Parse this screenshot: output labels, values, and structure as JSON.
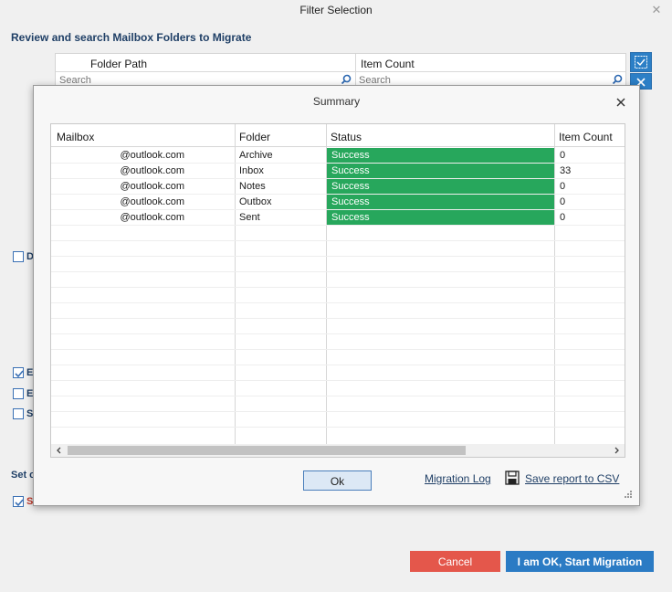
{
  "window": {
    "title": "Filter Selection",
    "heading": "Review and search Mailbox Folders to Migrate"
  },
  "folder_grid": {
    "columns": [
      "Folder Path",
      "Item Count"
    ],
    "search_placeholder": "Search"
  },
  "outer_options": {
    "check_labels": [
      "D",
      "E",
      "E",
      "S"
    ],
    "check_states": [
      false,
      true,
      false,
      false
    ],
    "set_label": "Set c",
    "bottom_check_label": "S",
    "bottom_check_state": true
  },
  "buttons": {
    "cancel": "Cancel",
    "start": "I am OK, Start Migration"
  },
  "summary": {
    "title": "Summary",
    "columns": [
      "Mailbox",
      "Folder",
      "Status",
      "Item Count"
    ],
    "rows": [
      {
        "mailbox": "@outlook.com",
        "folder": "Archive",
        "status": "Success",
        "count": "0"
      },
      {
        "mailbox": "@outlook.com",
        "folder": "Inbox",
        "status": "Success",
        "count": "33"
      },
      {
        "mailbox": "@outlook.com",
        "folder": "Notes",
        "status": "Success",
        "count": "0"
      },
      {
        "mailbox": "@outlook.com",
        "folder": "Outbox",
        "status": "Success",
        "count": "0"
      },
      {
        "mailbox": "@outlook.com",
        "folder": "Sent",
        "status": "Success",
        "count": "0"
      }
    ],
    "ok_label": "Ok",
    "log_link": "Migration Log",
    "save_link": "Save report to CSV",
    "status_color": "#27a75c"
  },
  "colors": {
    "accent": "#2b7bc4",
    "cancel": "#e4574b",
    "heading": "#1f3f66"
  }
}
